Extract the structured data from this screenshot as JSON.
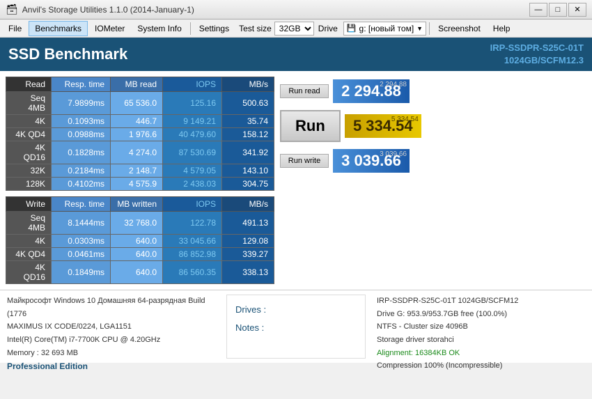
{
  "titleBar": {
    "title": "Anvil's Storage Utilities 1.1.0 (2014-January-1)",
    "minimize": "—",
    "maximize": "□",
    "close": "✕"
  },
  "menu": {
    "file": "File",
    "benchmarks": "Benchmarks",
    "iometer": "IOMeter",
    "systemInfo": "System Info",
    "settings": "Settings",
    "testSizeLabel": "Test size",
    "testSizeValue": "32GB",
    "driveLabel": "Drive",
    "driveName": "g: [новый том]",
    "screenshot": "Screenshot",
    "help": "Help"
  },
  "header": {
    "title": "SSD Benchmark",
    "model": "IRP-SSDPR-S25C-01T",
    "modelDetail": "1024GB/SCFM12.3"
  },
  "readTable": {
    "headers": [
      "Read",
      "Resp. time",
      "MB read",
      "IOPS",
      "MB/s"
    ],
    "rows": [
      [
        "Seq 4MB",
        "7.9899ms",
        "65 536.0",
        "125.16",
        "500.63"
      ],
      [
        "4K",
        "0.1093ms",
        "446.7",
        "9 149.21",
        "35.74"
      ],
      [
        "4K QD4",
        "0.0988ms",
        "1 976.6",
        "40 479.60",
        "158.12"
      ],
      [
        "4K QD16",
        "0.1828ms",
        "4 274.0",
        "87 530.69",
        "341.92"
      ],
      [
        "32K",
        "0.2184ms",
        "2 148.7",
        "4 579.05",
        "143.10"
      ],
      [
        "128K",
        "0.4102ms",
        "4 575.9",
        "2 438.03",
        "304.75"
      ]
    ]
  },
  "writeTable": {
    "headers": [
      "Write",
      "Resp. time",
      "MB written",
      "IOPS",
      "MB/s"
    ],
    "rows": [
      [
        "Seq 4MB",
        "8.1444ms",
        "32 768.0",
        "122.78",
        "491.13"
      ],
      [
        "4K",
        "0.0303ms",
        "640.0",
        "33 045.66",
        "129.08"
      ],
      [
        "4K QD4",
        "0.0461ms",
        "640.0",
        "86 852.98",
        "339.27"
      ],
      [
        "4K QD16",
        "0.1849ms",
        "640.0",
        "86 560.35",
        "338.13"
      ]
    ]
  },
  "scores": {
    "readSmall": "2 294.88",
    "readLarge": "2 294.88",
    "totalSmall": "5 334.54",
    "totalLarge": "5 334.54",
    "writeSmall": "3 039.66",
    "writeLarge": "3 039.66"
  },
  "buttons": {
    "runRead": "Run read",
    "run": "Run",
    "runWrite": "Run write"
  },
  "footer": {
    "os": "Майкрософт Windows 10 Домашняя 64-разрядная Build (1776",
    "code": "MAXIMUS IX CODE/0224, LGA1151",
    "cpu": "Intel(R) Core(TM) i7-7700K CPU @ 4.20GHz",
    "memory": "Memory : 32 693 MB",
    "edition": "Professional Edition",
    "drives": "Drives :",
    "notes": "Notes :",
    "rightTitle": "IRP-SSDPR-S25C-01T 1024GB/SCFM12",
    "driveInfo": "Drive G: 953.9/953.7GB free (100.0%)",
    "ntfs": "NTFS - Cluster size 4096B",
    "storage": "Storage driver  storahci",
    "alignment": "Alignment: 16384KB OK",
    "compression": "Compression 100% (Incompressible)"
  }
}
